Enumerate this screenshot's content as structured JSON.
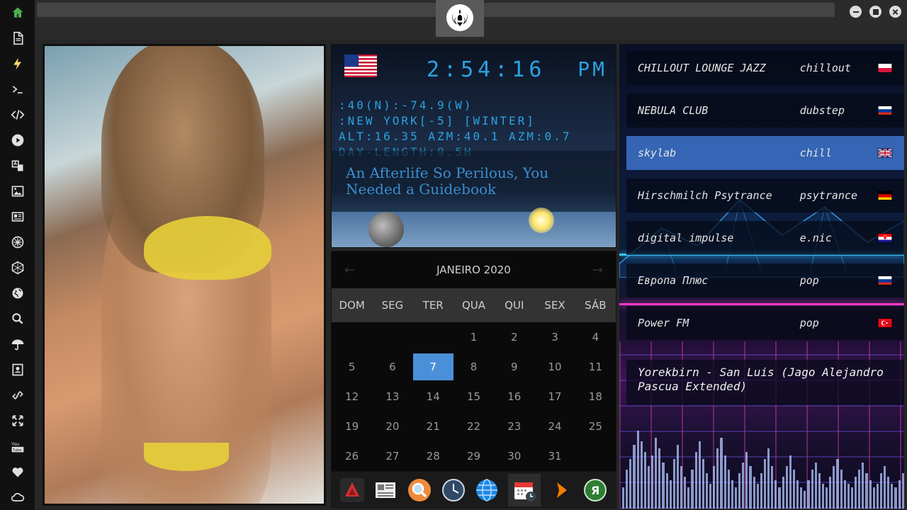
{
  "sidebar": {
    "items": [
      {
        "name": "home-icon"
      },
      {
        "name": "document-icon"
      },
      {
        "name": "bolt-icon"
      },
      {
        "name": "terminal-icon"
      },
      {
        "name": "code-icon"
      },
      {
        "name": "play-icon"
      },
      {
        "name": "translate-icon"
      },
      {
        "name": "image-icon"
      },
      {
        "name": "news-icon"
      },
      {
        "name": "rebel-icon"
      },
      {
        "name": "empire-icon"
      },
      {
        "name": "globe-icon"
      },
      {
        "name": "search-icon"
      },
      {
        "name": "umbrella-icon"
      },
      {
        "name": "contacts-icon"
      },
      {
        "name": "link-icon"
      },
      {
        "name": "expand-icon"
      },
      {
        "name": "youtube-icon"
      },
      {
        "name": "heart-icon"
      },
      {
        "name": "cloud-icon"
      }
    ]
  },
  "clock": {
    "time": "2:54:16",
    "ampm": "PM",
    "coords": ":40(N):-74.9(W)",
    "location": ":NEW YORK[-5] [WINTER]",
    "altitude": "ALT:16.35 AZM:40.1 AZM:0.7",
    "daylength": "DAY-LENGTH:9.5H",
    "headline": "An Afterlife So Perilous, You Needed a Guidebook"
  },
  "calendar": {
    "month": "JANEIRO 2020",
    "prev": "←",
    "next": "→",
    "weekdays": [
      "DOM",
      "SEG",
      "TER",
      "QUA",
      "QUI",
      "SEX",
      "SÁB"
    ],
    "days": [
      "",
      "",
      "",
      "1",
      "2",
      "3",
      "4",
      "5",
      "6",
      "7",
      "8",
      "9",
      "10",
      "11",
      "12",
      "13",
      "14",
      "15",
      "16",
      "17",
      "18",
      "19",
      "20",
      "21",
      "22",
      "23",
      "24",
      "25",
      "26",
      "27",
      "28",
      "29",
      "30",
      "31",
      ""
    ],
    "today": "7"
  },
  "radio": {
    "stations": [
      {
        "name": "CHILLOUT LOUNGE JAZZ",
        "genre": "chillout",
        "flag": "poland",
        "active": false
      },
      {
        "name": "NEBULA CLUB",
        "genre": "dubstep",
        "flag": "russia",
        "active": false
      },
      {
        "name": "skylab",
        "genre": "chill",
        "flag": "uk",
        "active": true
      },
      {
        "name": "Hirschmilch Psytrance",
        "genre": "psytrance",
        "flag": "germany",
        "active": false
      },
      {
        "name": "digital impulse",
        "genre": "e.nic",
        "flag": "croatia",
        "active": false
      },
      {
        "name": "Европа Плюс",
        "genre": "pop",
        "flag": "russia",
        "active": false
      },
      {
        "name": "Power FM",
        "genre": "pop",
        "flag": "turkey",
        "active": false
      }
    ],
    "now_playing": "Yorekbirn - San Luis (Jago Alejandro Pascua Extended)"
  },
  "dock": {
    "apps": [
      {
        "name": "vivaldi-app-icon"
      },
      {
        "name": "news-app-icon"
      },
      {
        "name": "search-app-icon"
      },
      {
        "name": "clock-app-icon"
      },
      {
        "name": "browser-app-icon"
      },
      {
        "name": "calendar-app-icon"
      },
      {
        "name": "player-app-icon"
      },
      {
        "name": "yandex-app-icon"
      }
    ]
  },
  "colors": {
    "accent_blue": "#4a90d9",
    "clock_cyan": "#2aa3e0",
    "station_active": "#3565b4",
    "home_green": "#4caf50"
  }
}
